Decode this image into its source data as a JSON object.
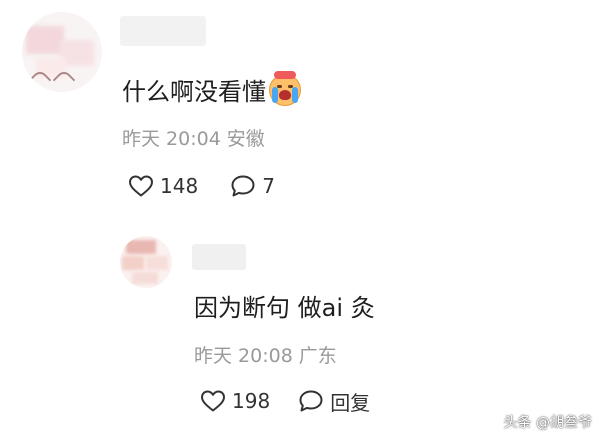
{
  "comments": [
    {
      "text": "什么啊没看懂",
      "emoji": "crying-face-emoji",
      "time": "昨天 20:04",
      "location": "安徽",
      "likes": "148",
      "replies": "7"
    }
  ],
  "reply": {
    "text": "因为断句 做ai 灸",
    "time": "昨天 20:08",
    "location": "广东",
    "likes": "198",
    "reply_label": "回复"
  },
  "watermark": "头条 @胡叁爷",
  "icons": {
    "like": "heart-outline-icon",
    "comment": "speech-bubble-icon"
  },
  "colors": {
    "meta_text": "#9a9a9a",
    "primary_text": "#1e1e1e",
    "icon_stroke": "#333333"
  }
}
